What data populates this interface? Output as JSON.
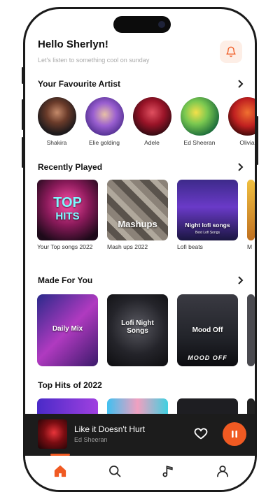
{
  "header": {
    "greeting": "Hello Sherlyn!",
    "subtitle": "Let's listen to something cool on sunday",
    "bell_icon": "bell-icon"
  },
  "sections": {
    "favourite_artist": "Your Favourite Artist",
    "recently_played": "Recently Played",
    "made_for_you": "Made For You",
    "top_hits": "Top Hits of 2022"
  },
  "artists": [
    {
      "name": "Shakira"
    },
    {
      "name": "Elie golding"
    },
    {
      "name": "Adele"
    },
    {
      "name": "Ed Sheeran"
    },
    {
      "name": "Olivia"
    }
  ],
  "recently_played": [
    {
      "label": "Your Top songs 2022",
      "cover_text_1": "TOP",
      "cover_text_2": "HITS"
    },
    {
      "label": "Mash ups 2022",
      "cover_text_1": "Mashups"
    },
    {
      "label": "Lofi beats",
      "cover_text_1": "Night lofi songs",
      "cover_text_2": "Best Lofi Songs"
    },
    {
      "label": "M"
    }
  ],
  "made_for_you": [
    {
      "cover_text": "Daily Mix"
    },
    {
      "cover_text": "Lofi Night Songs"
    },
    {
      "cover_text": "Mood Off",
      "cover_text_2": "MOOD OFF"
    }
  ],
  "player": {
    "title": "Like it Doesn't Hurt",
    "artist": "Ed Sheeran",
    "state": "playing"
  },
  "nav": {
    "active": "home",
    "items": [
      "home",
      "search",
      "music",
      "profile"
    ]
  },
  "colors": {
    "accent": "#f05a22",
    "player_bg": "#1c1c1c"
  }
}
